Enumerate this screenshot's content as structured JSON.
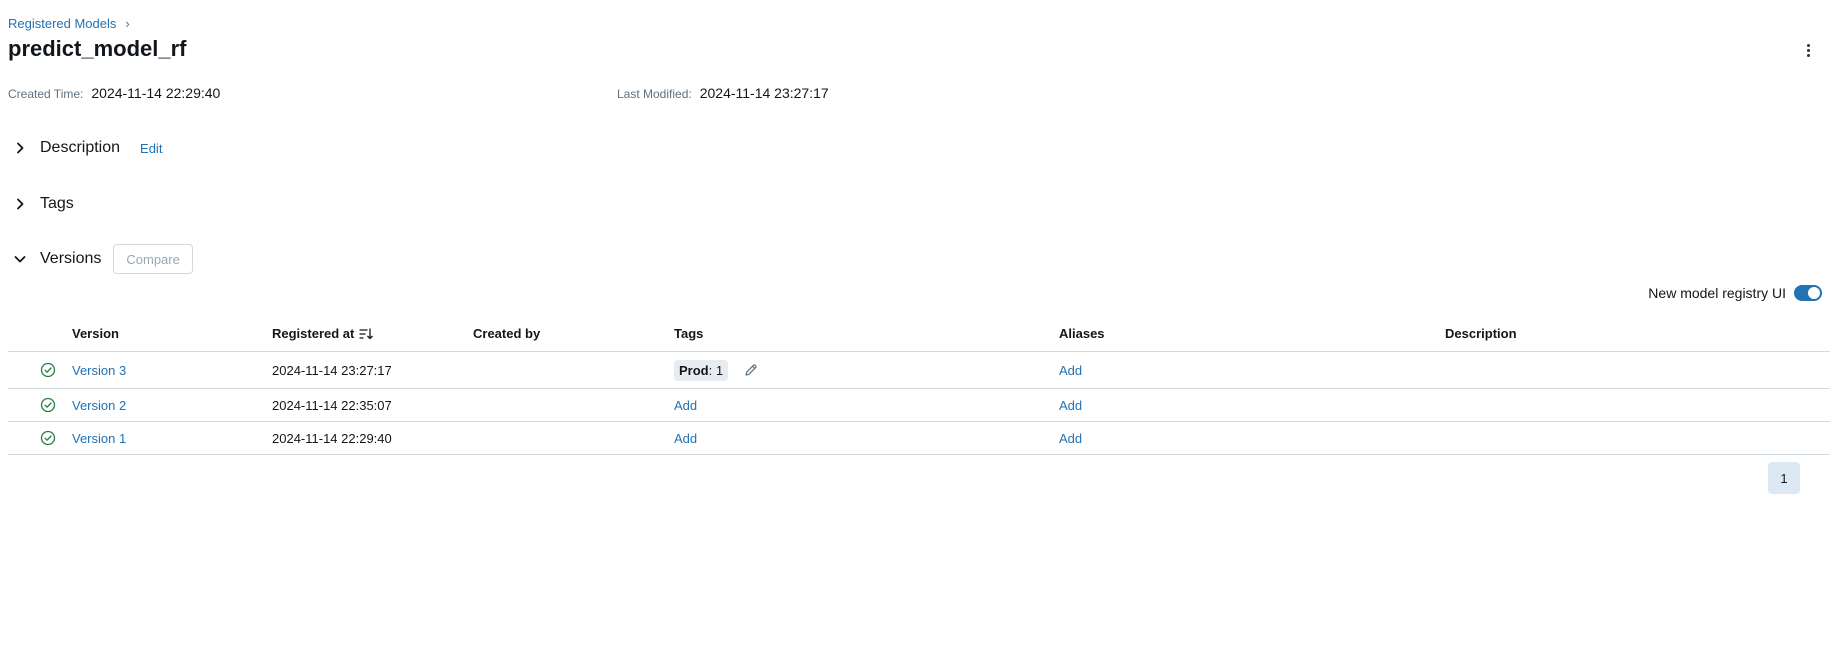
{
  "breadcrumb": {
    "parent": "Registered Models",
    "separator": "›"
  },
  "model": {
    "name": "predict_model_rf"
  },
  "meta": {
    "created_label": "Created Time:",
    "created_value": "2024-11-14 22:29:40",
    "modified_label": "Last Modified:",
    "modified_value": "2024-11-14 23:27:17"
  },
  "sections": {
    "description": {
      "title": "Description",
      "edit_label": "Edit",
      "expanded": false
    },
    "tags": {
      "title": "Tags",
      "expanded": false
    },
    "versions": {
      "title": "Versions",
      "compare_label": "Compare",
      "expanded": true
    }
  },
  "toggle": {
    "label": "New model registry UI",
    "on": true
  },
  "table": {
    "headers": {
      "version": "Version",
      "registered": "Registered at",
      "created_by": "Created by",
      "tags": "Tags",
      "aliases": "Aliases",
      "description": "Description"
    },
    "rows": [
      {
        "version": "Version 3",
        "registered": "2024-11-14 23:27:17",
        "created_by": "",
        "tag_key": "Prod",
        "tag_value": ": 1",
        "aliases": "Add",
        "description": ""
      },
      {
        "version": "Version 2",
        "registered": "2024-11-14 22:35:07",
        "created_by": "",
        "tags_add": "Add",
        "aliases": "Add",
        "description": ""
      },
      {
        "version": "Version 1",
        "registered": "2024-11-14 22:29:40",
        "created_by": "",
        "tags_add": "Add",
        "aliases": "Add",
        "description": ""
      }
    ]
  },
  "pagination": {
    "current": "1"
  },
  "colors": {
    "link": "#2272b4",
    "status_ok": "#277c43",
    "toggle_on": "#2272b4"
  },
  "icons": {
    "breadcrumb_sep": "chevron-right-icon",
    "more": "kebab-menu-icon",
    "collapsed": "chevron-right-icon",
    "expanded": "chevron-down-icon",
    "sort": "sort-descending-icon",
    "status": "check-circle-icon",
    "edit_tags": "pencil-icon"
  }
}
